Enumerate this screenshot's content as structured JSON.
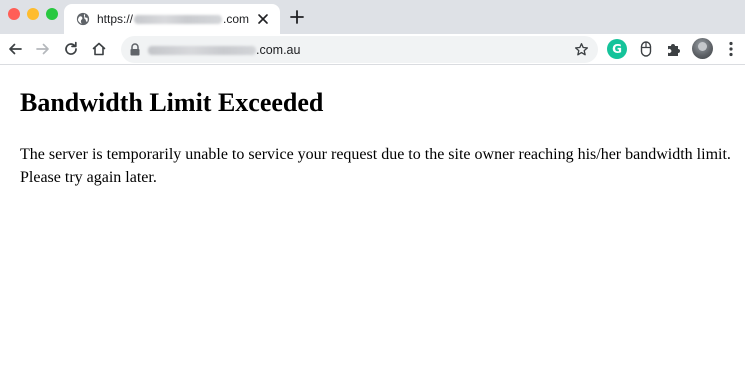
{
  "browser": {
    "tab": {
      "title_prefix": "https://",
      "title_suffix": ".com"
    },
    "address_bar": {
      "url_suffix": ".com.au"
    },
    "icons": {
      "globe": "globe-icon",
      "close": "close-icon",
      "new_tab": "plus-icon",
      "back": "back-arrow-icon",
      "forward": "forward-arrow-icon",
      "reload": "reload-icon",
      "home": "home-icon",
      "lock": "lock-icon",
      "bookmark": "star-icon",
      "grammarly": "grammarly-icon",
      "mouse": "mouse-icon",
      "extensions": "puzzle-icon",
      "profile": "avatar",
      "menu": "kebab-menu-icon"
    },
    "grammarly_letter": "G",
    "colors": {
      "tabstrip": "#dee1e6",
      "traffic_close": "#ff5f57",
      "traffic_minimize": "#febc2e",
      "traffic_zoom": "#28c840",
      "grammarly": "#15c39a"
    }
  },
  "page": {
    "heading": "Bandwidth Limit Exceeded",
    "message": "The server is temporarily unable to service your request due to the site owner reaching his/her bandwidth limit. Please try again later."
  }
}
